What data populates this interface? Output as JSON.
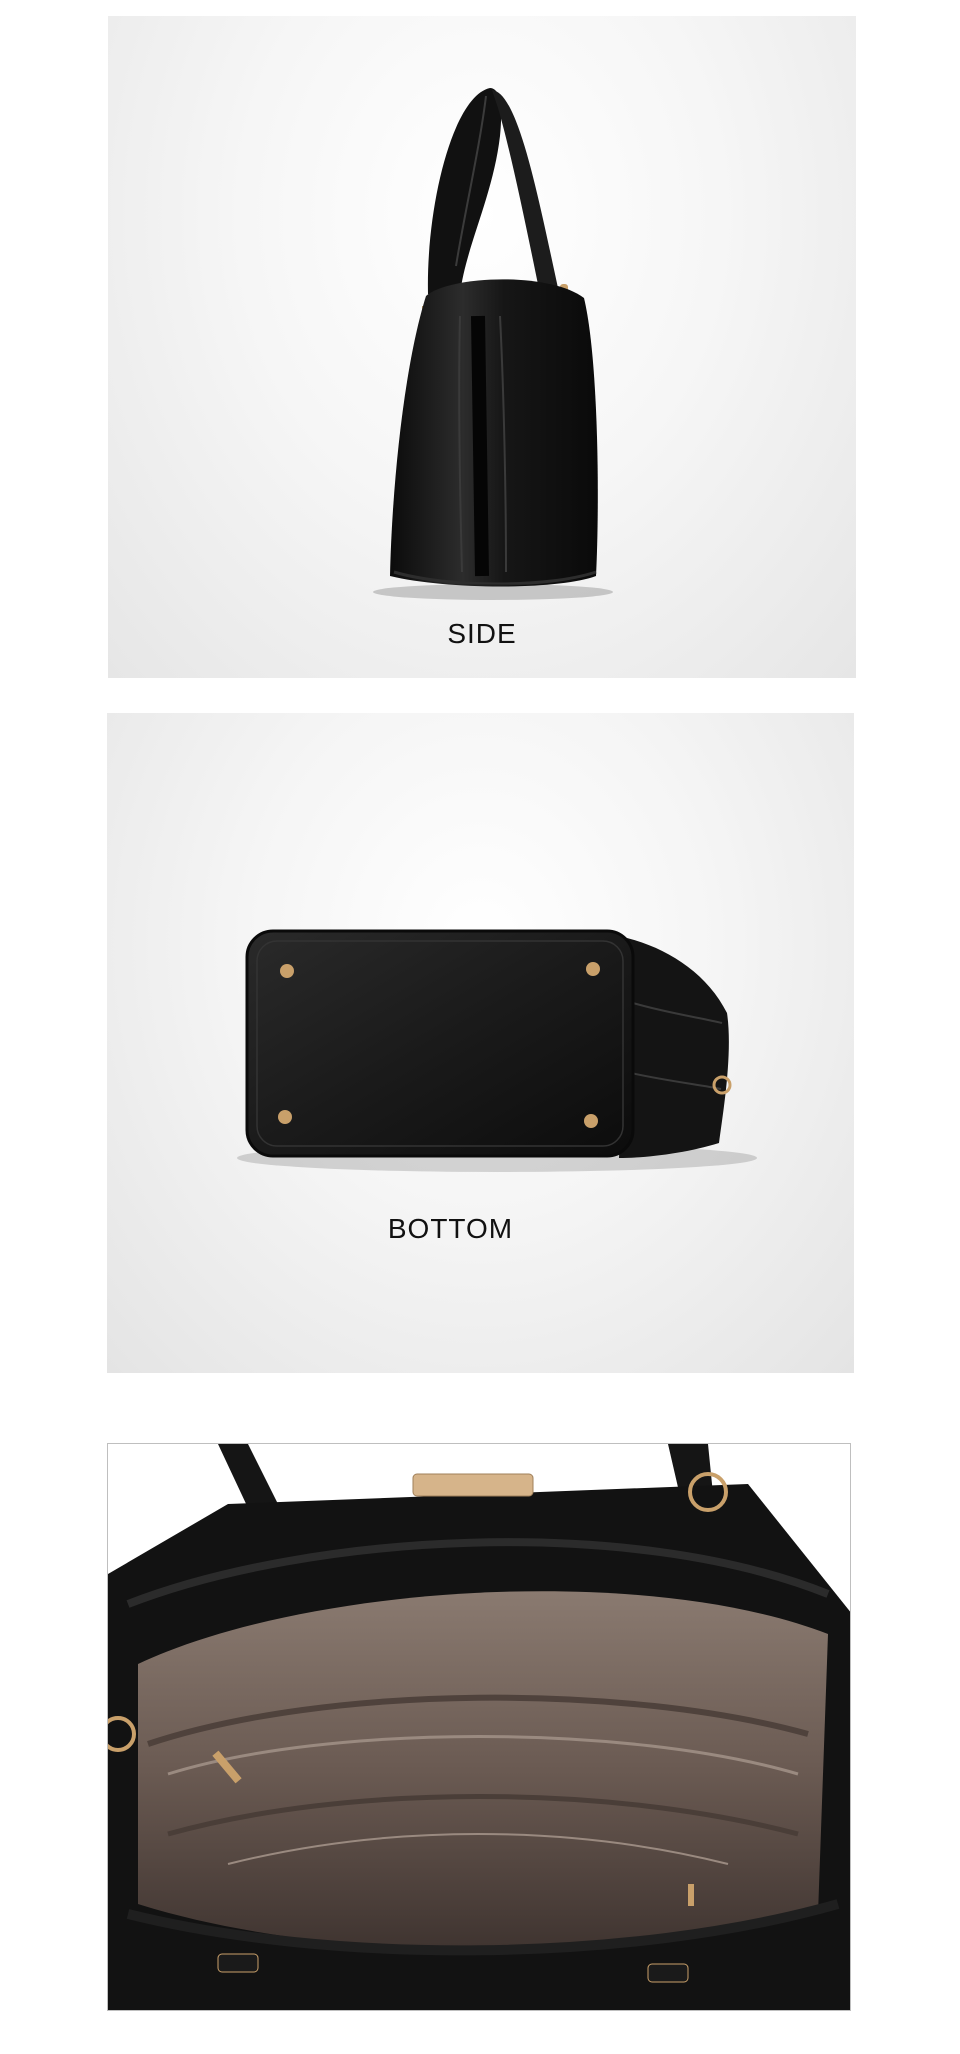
{
  "panels": [
    {
      "caption": "SIDE",
      "view": "side-view"
    },
    {
      "caption": "BOTTOM",
      "view": "bottom-view"
    },
    {
      "caption": "",
      "view": "interior-view"
    }
  ],
  "colors": {
    "leather": "#141414",
    "leather_highlight": "#3a3a3a",
    "hardware_gold": "#c9a06a",
    "lining": "#7a6a60",
    "lining_dark": "#3f3430"
  }
}
